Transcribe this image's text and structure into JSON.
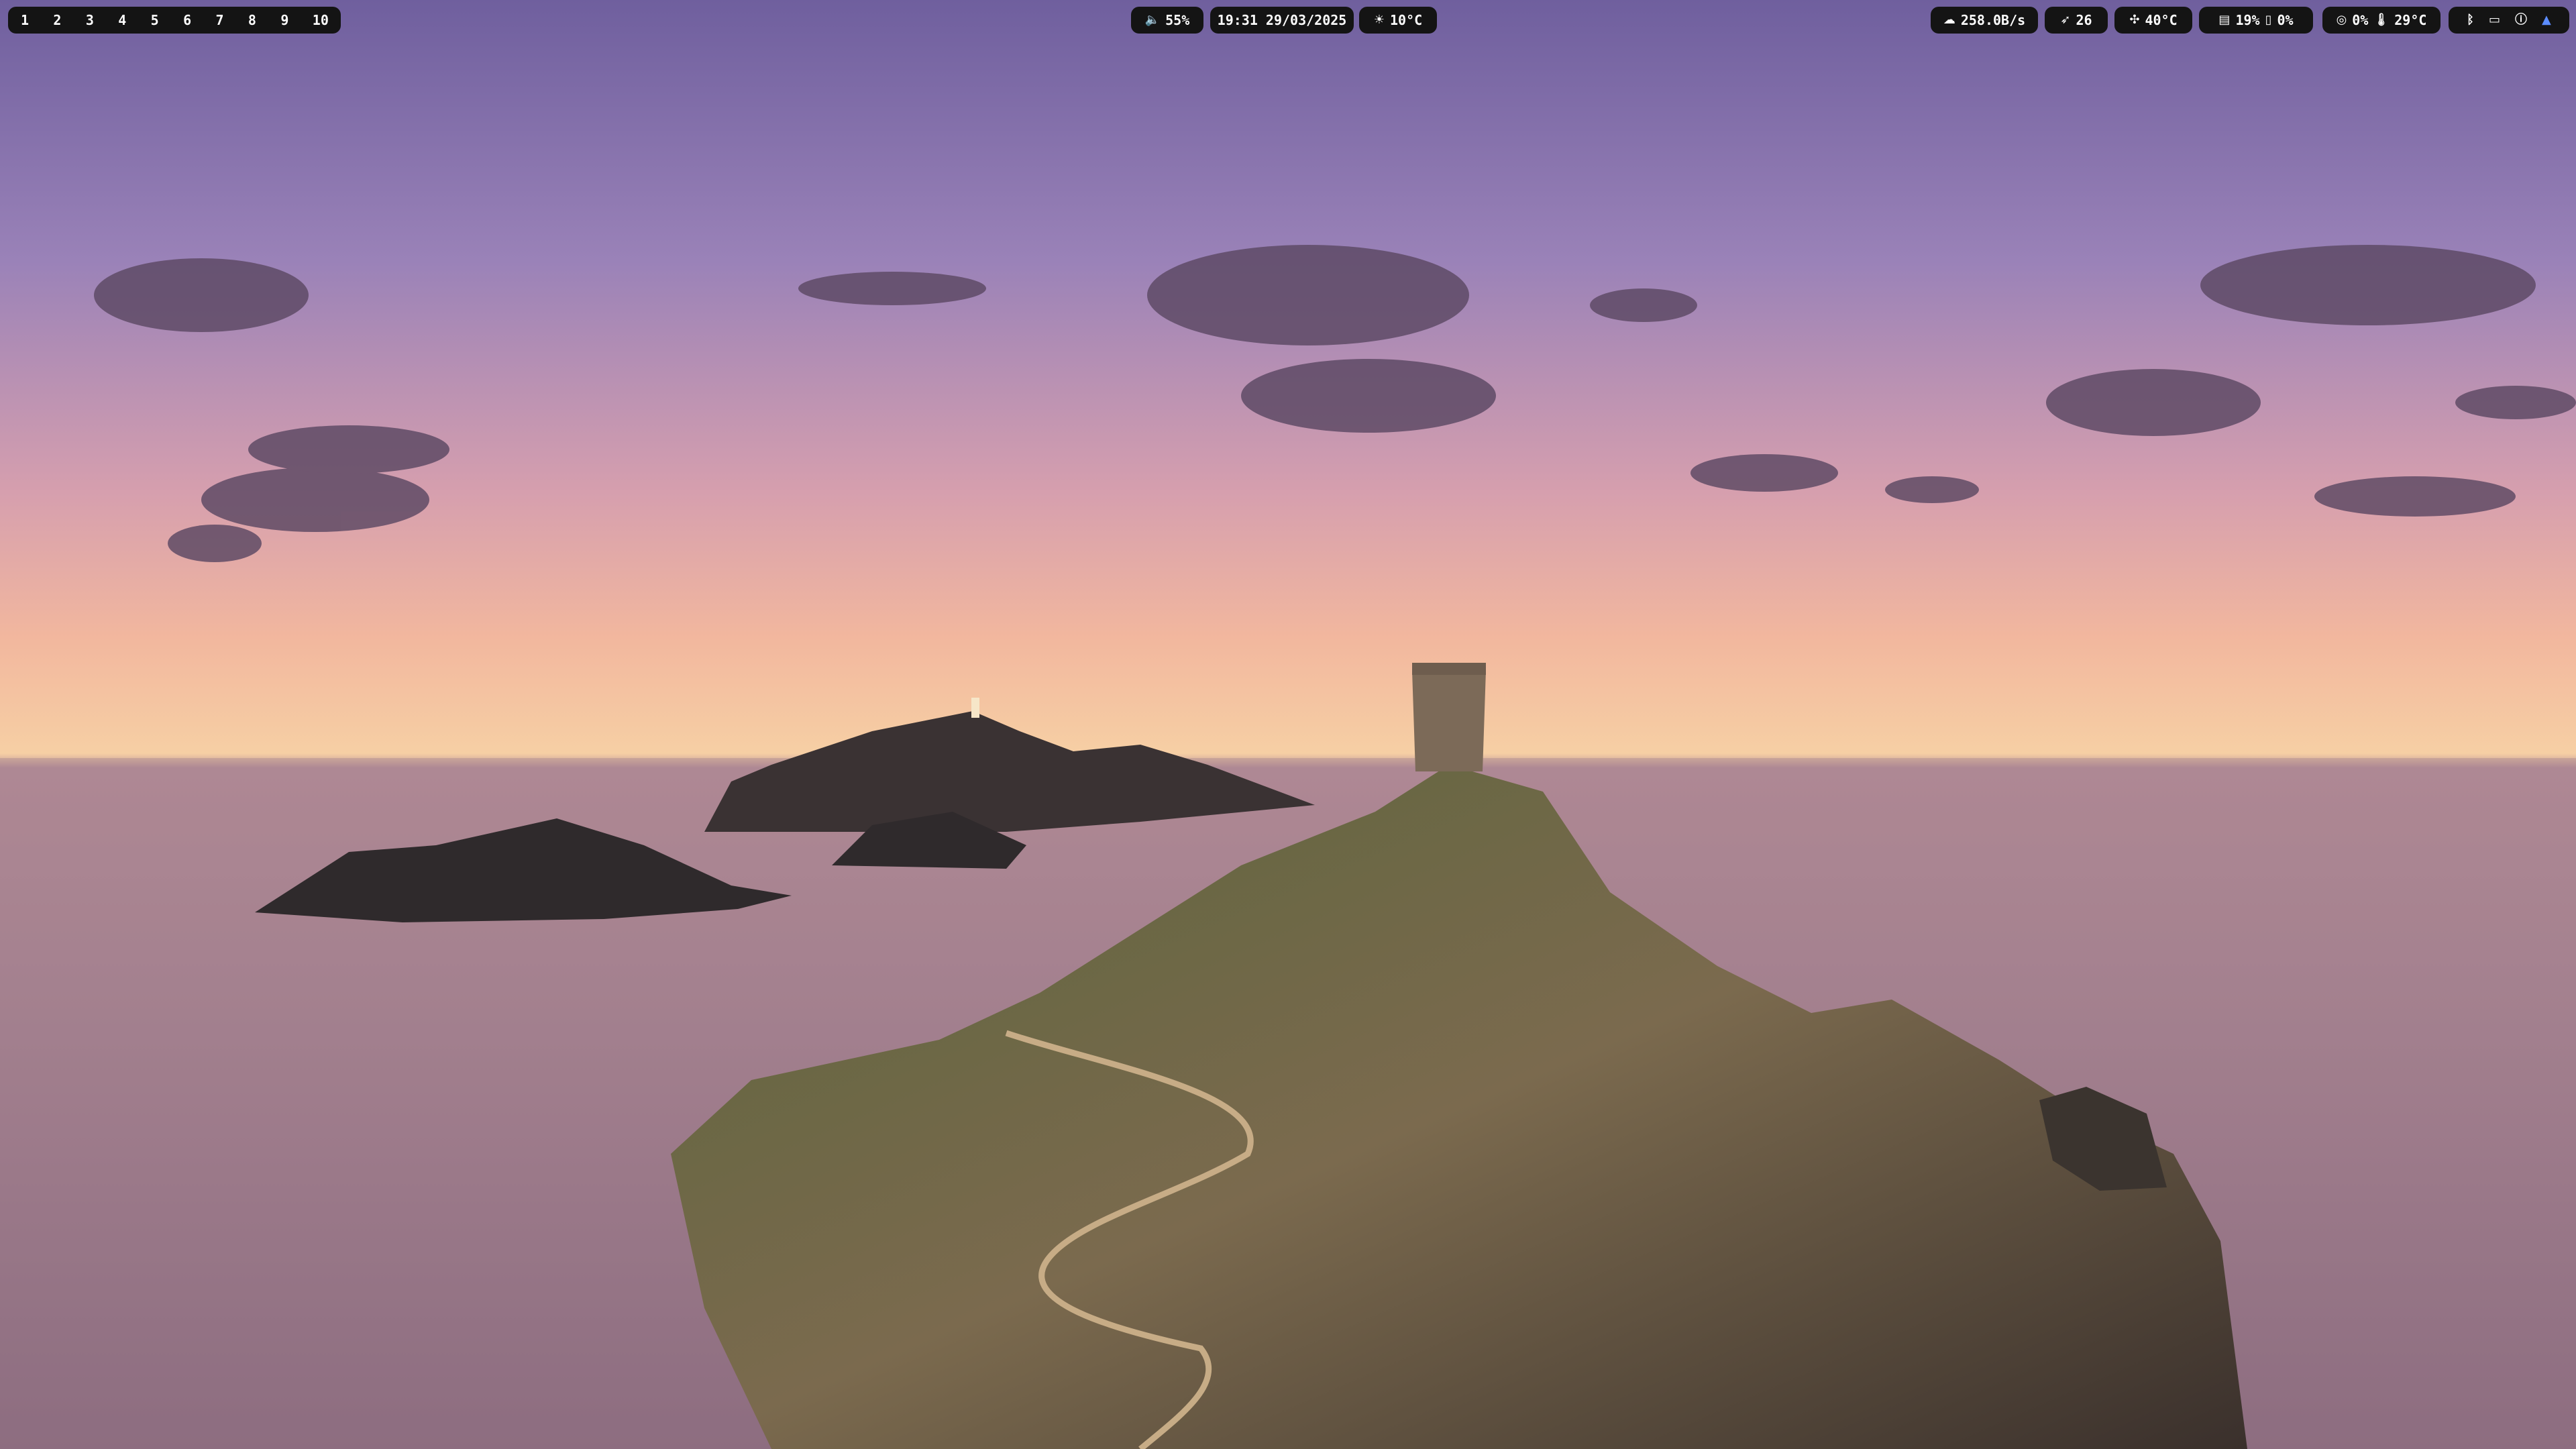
{
  "workspaces": [
    "1",
    "2",
    "3",
    "4",
    "5",
    "6",
    "7",
    "8",
    "9",
    "10"
  ],
  "volume": {
    "icon": "speaker-icon",
    "value": "55%"
  },
  "clock": {
    "value": "19:31 29/03/2025"
  },
  "weather": {
    "icon": "sun-icon",
    "value": "10°C"
  },
  "network": {
    "icon": "cloud-download-icon",
    "value": "258.0B/s"
  },
  "updates": {
    "icon": "rocket-icon",
    "value": "26"
  },
  "gpu": {
    "icon": "fan-icon",
    "value": "40°C"
  },
  "memory": {
    "icon": "memory-icon",
    "value": "19%",
    "swap_icon": "drive-icon",
    "swap_value": "0%"
  },
  "cpu": {
    "icon": "cpu-icon",
    "value": "0%",
    "temp_icon": "thermometer-icon",
    "temp_value": "29°C"
  },
  "tray": [
    "bluetooth-icon",
    "battery-icon",
    "info-icon",
    "triangle-icon"
  ],
  "colors": {
    "bar_bg": "#141414",
    "text": "#ffffff",
    "accent": "#5b8cff"
  }
}
